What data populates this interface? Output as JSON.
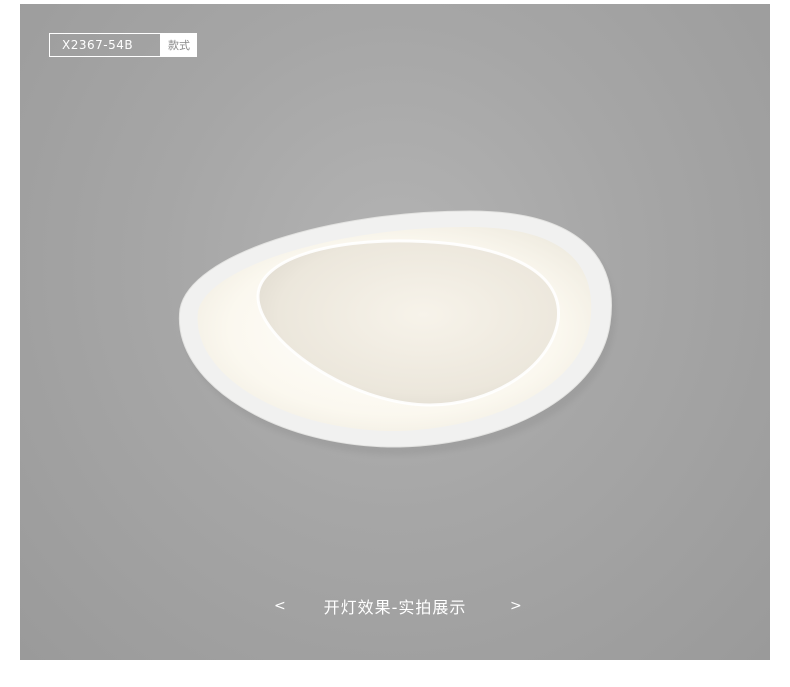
{
  "product": {
    "model_code": "X2367-54B",
    "model_label": "款式"
  },
  "gallery": {
    "prev_symbol": "<",
    "next_symbol": ">",
    "caption": "开灯效果-实拍展示"
  },
  "colors": {
    "background": "#a8a8a8",
    "lamp_frame": "#f2f2f2",
    "lamp_glow": "#fffdf6",
    "text": "#ffffff"
  }
}
